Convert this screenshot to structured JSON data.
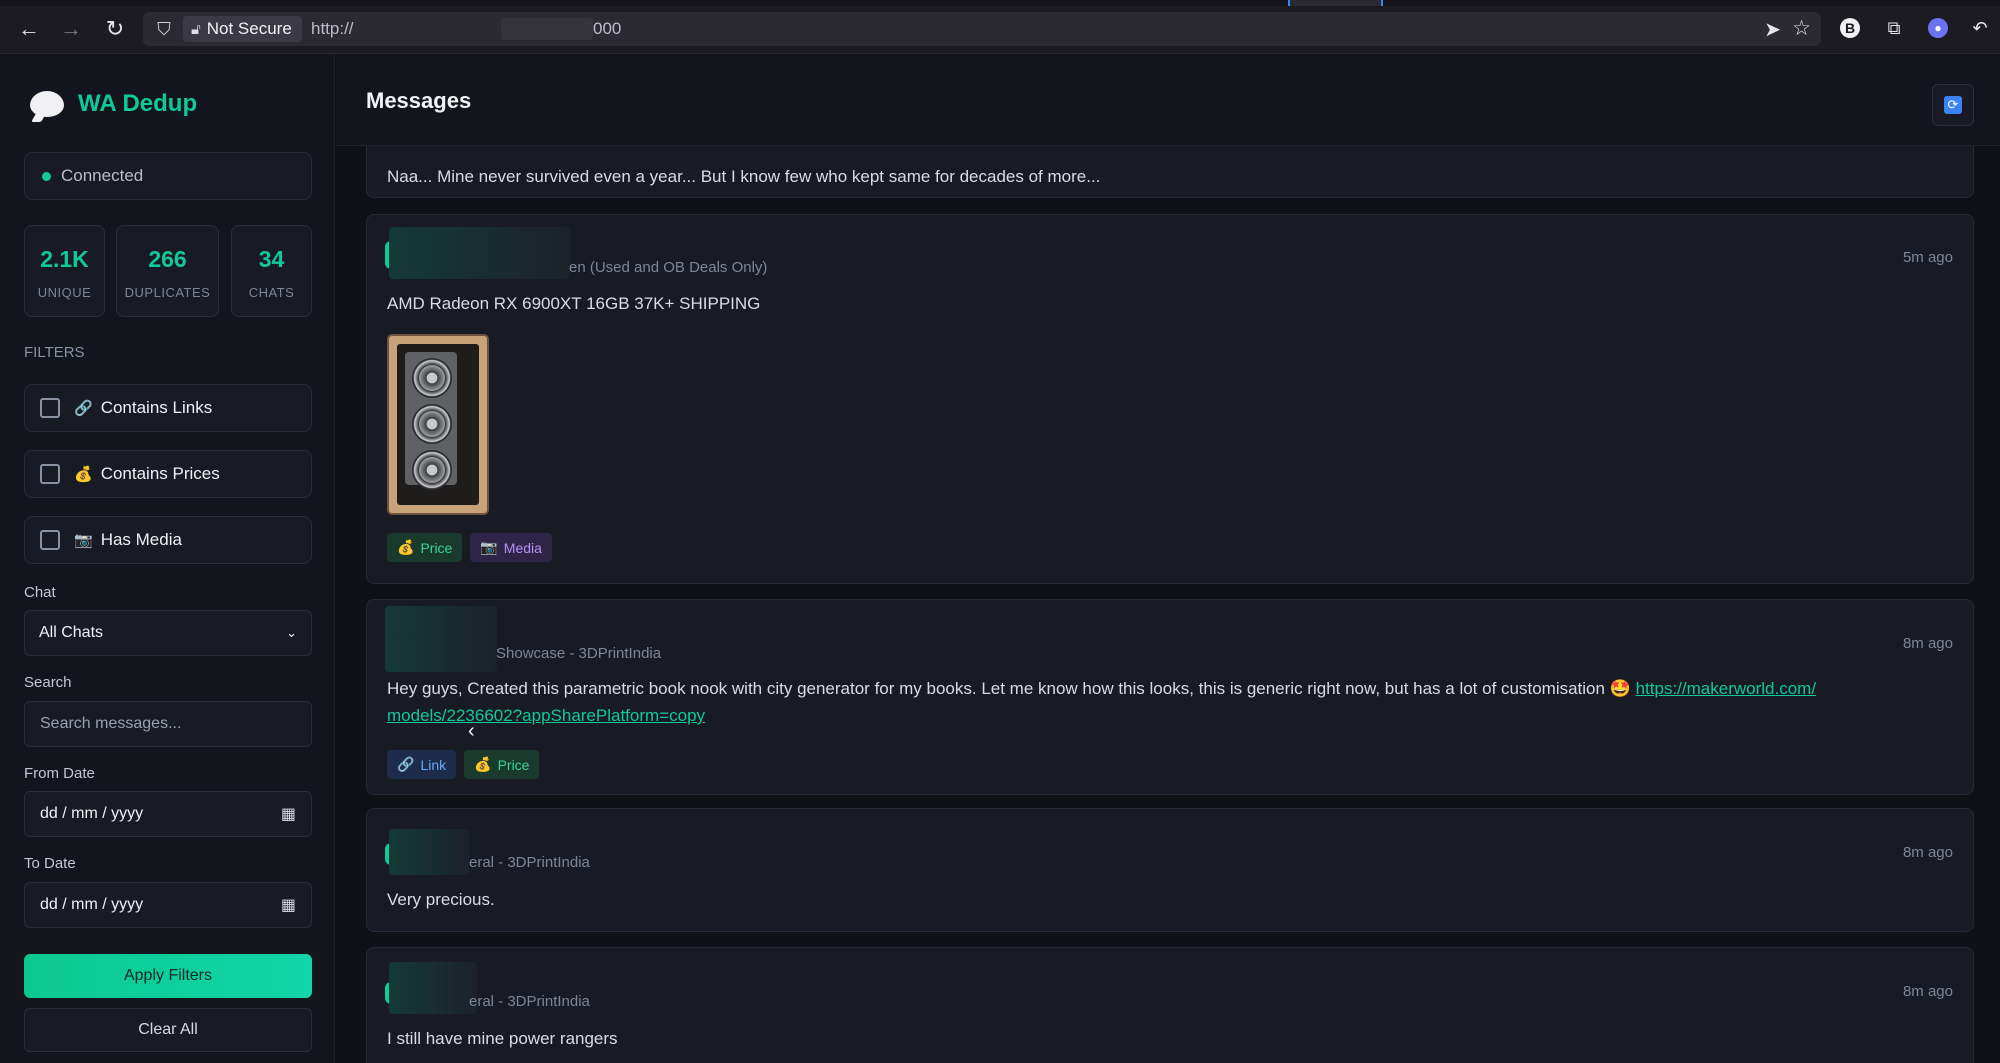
{
  "browser": {
    "lock_label": "Not Secure",
    "url_prefix": "http://",
    "url_suffix": "000"
  },
  "sidebar": {
    "brand": "WA Dedup",
    "status": "Connected",
    "stats": [
      {
        "value": "2.1K",
        "label": "UNIQUE"
      },
      {
        "value": "266",
        "label": "DUPLICATES"
      },
      {
        "value": "34",
        "label": "CHATS"
      }
    ],
    "filters_heading": "FILTERS",
    "filters": [
      {
        "icon": "🔗",
        "label": "Contains Links"
      },
      {
        "icon": "💰",
        "label": "Contains Prices"
      },
      {
        "icon": "📷",
        "label": "Has Media"
      }
    ],
    "chat_label": "Chat",
    "chat_selected": "All Chats",
    "search_label": "Search",
    "search_placeholder": "Search messages...",
    "from_label": "From Date",
    "from_value": "dd / mm / yyyy",
    "to_label": "To Date",
    "to_value": "dd / mm / yyyy",
    "apply": "Apply Filters",
    "clear": "Clear All"
  },
  "main": {
    "title": "Messages",
    "refresh_icon": "🔄",
    "messages": [
      {
        "body": "Naa... Mine never survived even a year... But I know few who kept same for decades of more..."
      },
      {
        "chat": "en (Used and OB Deals Only)",
        "time": "5m ago",
        "body": "AMD Radeon RX 6900XT 16GB 37K+ SHIPPING",
        "tags": [
          {
            "icon": "💰",
            "label": "Price"
          },
          {
            "icon": "📷",
            "label": "Media"
          }
        ]
      },
      {
        "chat": "Showcase - 3DPrintIndia",
        "time": "8m ago",
        "body": "Hey guys, Created this parametric book nook with city generator for my books. Let me know how this looks, this is generic right now, but has a lot of customisation 🤩 ",
        "link": "https://makerworld.com/models/2236602?appSharePlatform=copy",
        "link_line1": "https://makerworld.com/",
        "link_line2": "models/2236602?appSharePlatform=copy",
        "tags": [
          {
            "icon": "🔗",
            "label": "Link"
          },
          {
            "icon": "💰",
            "label": "Price"
          }
        ]
      },
      {
        "chat": "eral - 3DPrintIndia",
        "time": "8m ago",
        "body": "Very precious."
      },
      {
        "chat": "eral - 3DPrintIndia",
        "time": "8m ago",
        "body": "I still have mine power rangers"
      }
    ]
  }
}
